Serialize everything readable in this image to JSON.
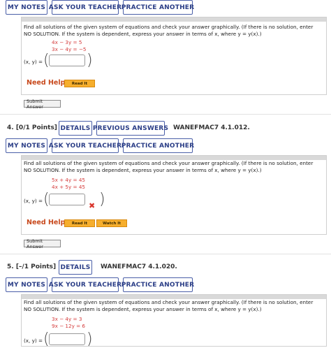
{
  "top_toolbar": {
    "my_notes": "MY NOTES",
    "ask_teacher": "ASK YOUR TEACHER",
    "practice_another": "PRACTICE ANOTHER"
  },
  "question3": {
    "prompt": "Find all solutions of the given system of equations and check your answer graphically. (If there is no solution, enter NO SOLUTION. If the system is dependent, express your answer in terms of x, where y = y(x).)",
    "eq1": "4x − 3y =  5",
    "eq2": "3x − 4y = −5",
    "xy_label": "(x, y) =",
    "answer_value": "",
    "need_help": "Need Help?",
    "read_it": "Read It",
    "submit": "Submit Answer"
  },
  "question4": {
    "number": "4.  [0/1 Points]",
    "details": "DETAILS",
    "previous_answers": "PREVIOUS ANSWERS",
    "code": "WANEFMAC7 4.1.012.",
    "my_notes": "MY NOTES",
    "ask_teacher": "ASK YOUR TEACHER",
    "practice_another": "PRACTICE ANOTHER",
    "prompt": "Find all solutions of the given system of equations and check your answer graphically. (If there is no solution, enter NO SOLUTION. If the system is dependent, express your answer in terms of x, where y = y(x).)",
    "eq1": "5x + 4y = 45",
    "eq2": "4x + 5y = 45",
    "xy_label": "(x, y) =",
    "answer_value": "",
    "status_mark": "✖",
    "need_help": "Need Help?",
    "read_it": "Read It",
    "watch_it": "Watch It",
    "submit": "Submit Answer"
  },
  "question5": {
    "number": "5.  [–/1 Points]",
    "details": "DETAILS",
    "code": "WANEFMAC7 4.1.020.",
    "my_notes": "MY NOTES",
    "ask_teacher": "ASK YOUR TEACHER",
    "practice_another": "PRACTICE ANOTHER",
    "prompt": "Find all solutions of the given system of equations and check your answer graphically. (If there is no solution, enter NO SOLUTION. If the system is dependent, express your answer in terms of x, where y = y(x).)",
    "eq1": "3x −   4y = 3",
    "eq2": "9x − 12y = 6",
    "xy_label": "(x, y) =",
    "answer_value": ""
  }
}
